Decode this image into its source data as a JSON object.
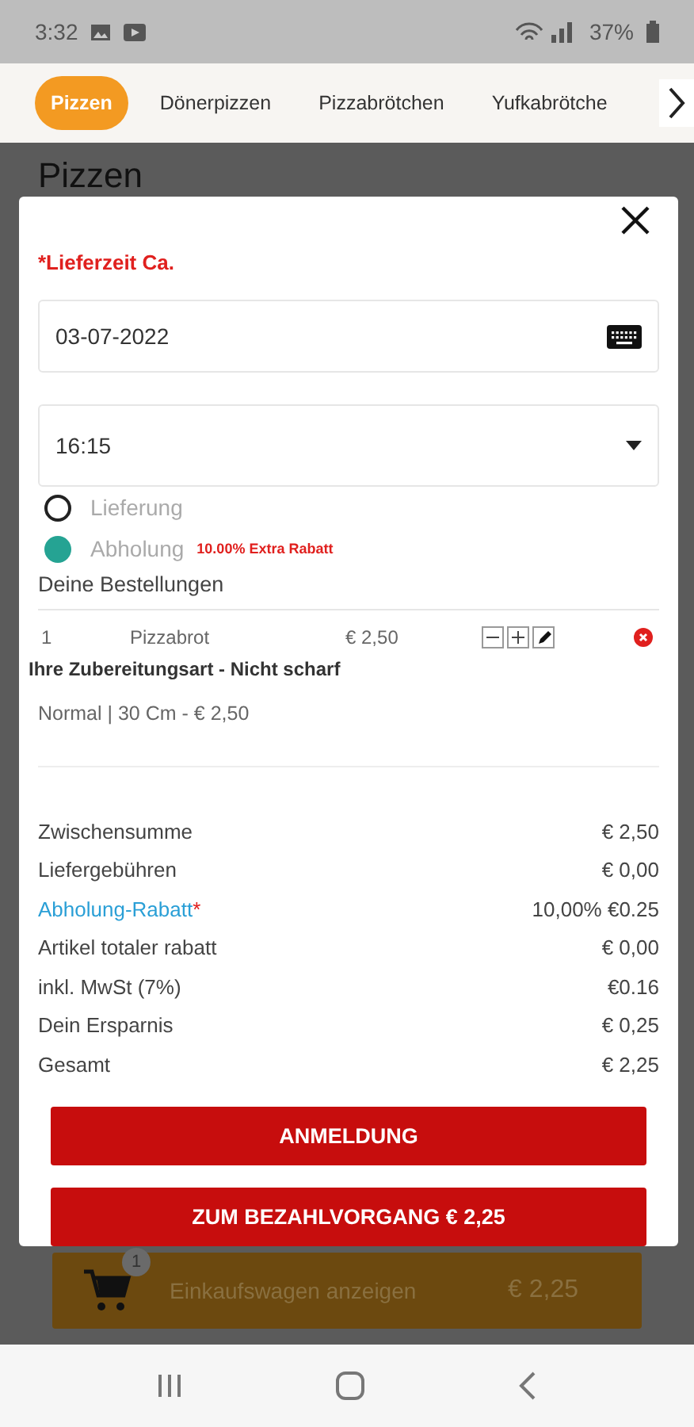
{
  "status_bar": {
    "time": "3:32",
    "battery": "37%"
  },
  "tabs": [
    {
      "label": "Pizzen",
      "selected": true
    },
    {
      "label": "Dönerpizzen",
      "selected": false
    },
    {
      "label": "Pizzabrötchen",
      "selected": false
    },
    {
      "label": "Yufkabrötche",
      "selected": false
    }
  ],
  "page_title": "Pizzen",
  "modal": {
    "time_label": "*Lieferzeit Ca.",
    "date": "03-07-2022",
    "time": "16:15",
    "options": [
      {
        "label": "Lieferung",
        "selected": false
      },
      {
        "label": "Abholung",
        "selected": true,
        "note": "10.00% Extra Rabatt"
      }
    ],
    "orders_heading": "Deine Bestellungen",
    "items": [
      {
        "qty": "1",
        "name": "Pizzabrot",
        "price": "€ 2,50",
        "preparation": "Ihre Zubereitungsart - Nicht scharf",
        "variant": "Normal | 30 Cm - € 2,50"
      }
    ],
    "summary": [
      {
        "label": "Zwischensumme",
        "value": "€ 2,50",
        "kind": "plain"
      },
      {
        "label": "Liefergebühren",
        "value": "€ 0,00",
        "kind": "plain"
      },
      {
        "label": "Abholung-Rabatt",
        "marker": "*",
        "value": "10,00% €0.25",
        "kind": "link"
      },
      {
        "label": "Artikel totaler rabatt",
        "value": "€ 0,00",
        "kind": "plain"
      },
      {
        "label": "inkl. MwSt (7%)",
        "value": "€0.16",
        "kind": "plain"
      },
      {
        "label": "Dein Ersparnis",
        "value": "€ 0,25",
        "kind": "plain"
      },
      {
        "label": "Gesamt",
        "value": "€ 2,25",
        "kind": "plain"
      }
    ],
    "buttons": [
      "ANMELDUNG",
      "ZUM BEZAHLVORGANG € 2,25"
    ]
  },
  "cart_bar": {
    "count": "1",
    "label": "Einkaufswagen anzeigen",
    "total": "€ 2,25"
  }
}
